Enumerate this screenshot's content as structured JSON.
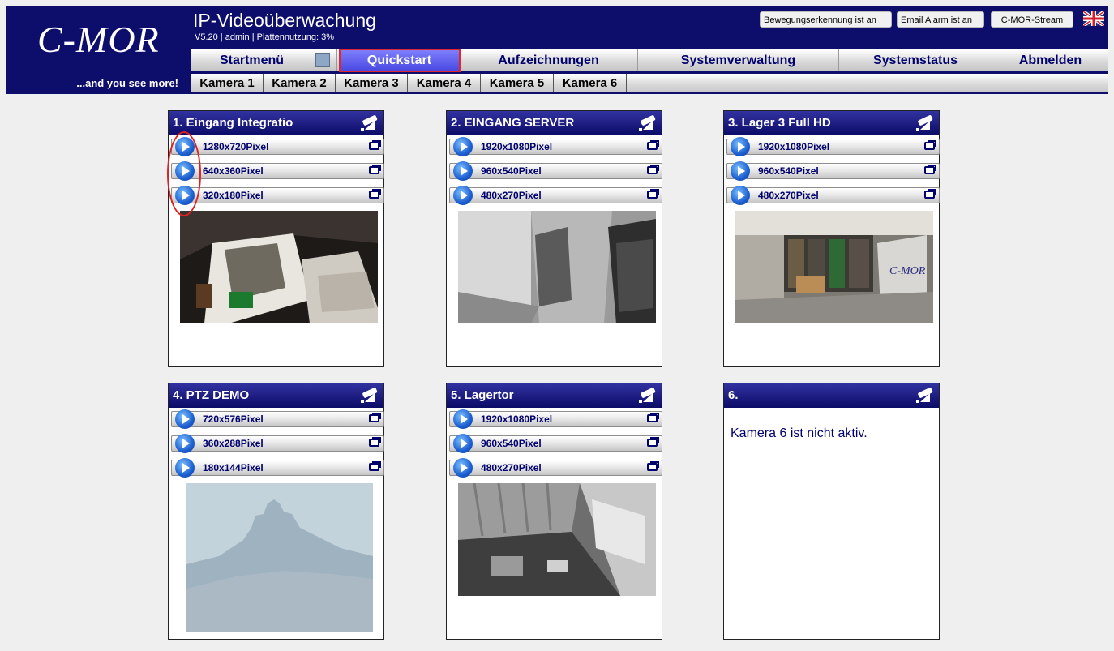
{
  "header": {
    "brand": "C-MOR",
    "slogan": "...and you see more!",
    "title": "IP-Videoüberwachung",
    "subtitle": "V5.20 | admin | Plattennutzung: 3%",
    "buttons": {
      "motion": "Bewegungserkennung ist an",
      "email": "Email Alarm ist an",
      "stream": "C-MOR-Stream"
    },
    "flag_icon": "uk-flag-icon"
  },
  "nav": {
    "start": "Startmenü",
    "quick": "Quickstart",
    "recordings": "Aufzeichnungen",
    "admin": "Systemverwaltung",
    "status": "Systemstatus",
    "logout": "Abmelden",
    "active": "Quickstart"
  },
  "subnav": [
    "Kamera 1",
    "Kamera 2",
    "Kamera 3",
    "Kamera 4",
    "Kamera 5",
    "Kamera 6"
  ],
  "colors": {
    "navy": "#0d0d6b",
    "active_tab": "#5a5ae8",
    "highlight": "#e0252c"
  },
  "cameras": [
    {
      "title": "1. Eingang Integratio",
      "resolutions": [
        "1280x720Pixel",
        "640x360Pixel",
        "320x180Pixel"
      ]
    },
    {
      "title": "2. EINGANG SERVER",
      "resolutions": [
        "1920x1080Pixel",
        "960x540Pixel",
        "480x270Pixel"
      ]
    },
    {
      "title": "3. Lager 3 Full HD",
      "resolutions": [
        "1920x1080Pixel",
        "960x540Pixel",
        "480x270Pixel"
      ]
    },
    {
      "title": "4. PTZ DEMO",
      "resolutions": [
        "720x576Pixel",
        "360x288Pixel",
        "180x144Pixel"
      ]
    },
    {
      "title": "5. Lagertor",
      "resolutions": [
        "1920x1080Pixel",
        "960x540Pixel",
        "480x270Pixel"
      ]
    },
    {
      "title": "6.",
      "message": "Kamera 6 ist nicht aktiv."
    }
  ]
}
